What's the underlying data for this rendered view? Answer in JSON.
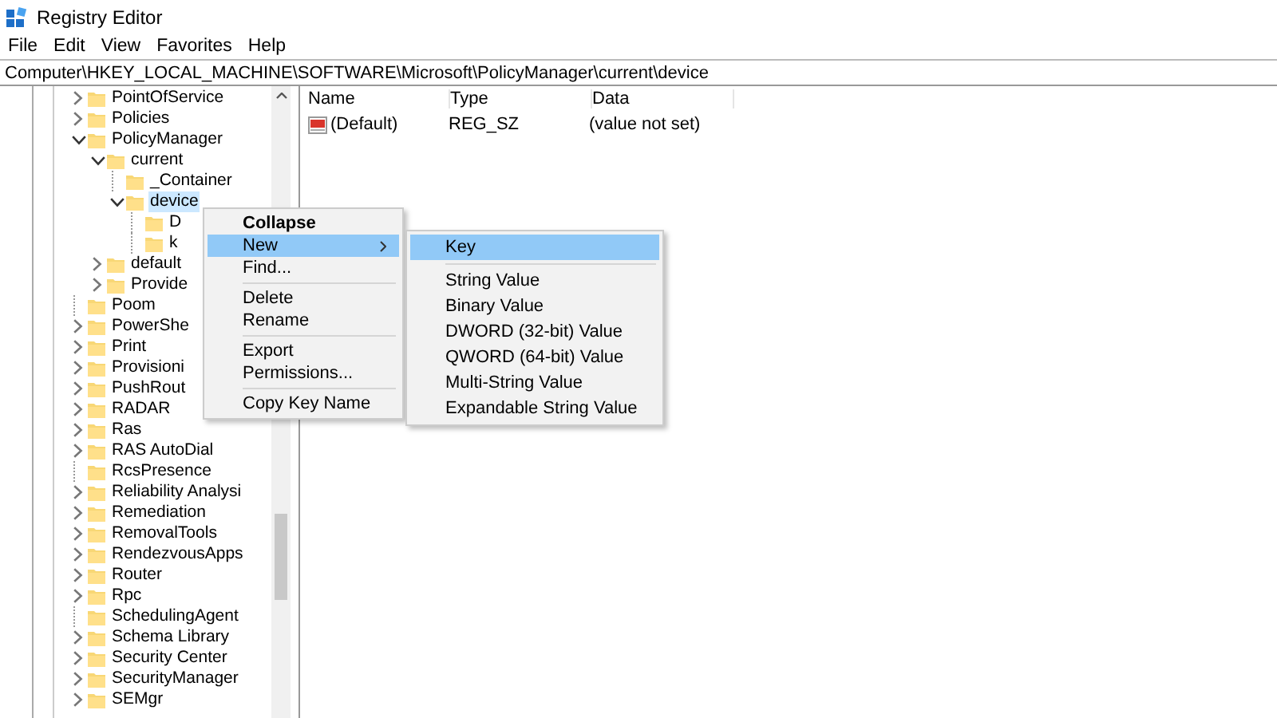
{
  "window": {
    "title": "Registry Editor"
  },
  "menu_bar": [
    "File",
    "Edit",
    "View",
    "Favorites",
    "Help"
  ],
  "address_bar": {
    "value": "Computer\\HKEY_LOCAL_MACHINE\\SOFTWARE\\Microsoft\\PolicyManager\\current\\device"
  },
  "tree": [
    {
      "label": "PointOfService",
      "kind": "branch",
      "expanded": false,
      "selected": false
    },
    {
      "label": "Policies",
      "kind": "branch",
      "expanded": false,
      "selected": false
    },
    {
      "label": "PolicyManager",
      "kind": "branch",
      "expanded": true,
      "selected": false,
      "children": [
        {
          "label": "current",
          "kind": "branch",
          "expanded": true,
          "selected": false,
          "children": [
            {
              "label": "_Container",
              "kind": "leaf",
              "selected": false
            },
            {
              "label": "device",
              "kind": "branch",
              "expanded": true,
              "selected": true,
              "children": [
                {
                  "label": "D",
                  "kind": "leaf",
                  "selected": false
                },
                {
                  "label": "k",
                  "kind": "leaf",
                  "selected": false
                }
              ]
            }
          ]
        },
        {
          "label": "default",
          "kind": "branch",
          "expanded": false,
          "selected": false
        },
        {
          "label": "Provide",
          "kind": "branch",
          "expanded": false,
          "selected": false
        }
      ]
    },
    {
      "label": "Poom",
      "kind": "leaf",
      "selected": false
    },
    {
      "label": "PowerShe",
      "kind": "branch",
      "expanded": false,
      "selected": false
    },
    {
      "label": "Print",
      "kind": "branch",
      "expanded": false,
      "selected": false
    },
    {
      "label": "Provisioni",
      "kind": "branch",
      "expanded": false,
      "selected": false
    },
    {
      "label": "PushRout",
      "kind": "branch",
      "expanded": false,
      "selected": false
    },
    {
      "label": "RADAR",
      "kind": "branch",
      "expanded": false,
      "selected": false
    },
    {
      "label": "Ras",
      "kind": "branch",
      "expanded": false,
      "selected": false
    },
    {
      "label": "RAS AutoDial",
      "kind": "branch",
      "expanded": false,
      "selected": false
    },
    {
      "label": "RcsPresence",
      "kind": "leaf",
      "selected": false
    },
    {
      "label": "Reliability Analysi",
      "kind": "branch",
      "expanded": false,
      "selected": false
    },
    {
      "label": "Remediation",
      "kind": "branch",
      "expanded": false,
      "selected": false
    },
    {
      "label": "RemovalTools",
      "kind": "branch",
      "expanded": false,
      "selected": false
    },
    {
      "label": "RendezvousApps",
      "kind": "branch",
      "expanded": false,
      "selected": false
    },
    {
      "label": "Router",
      "kind": "branch",
      "expanded": false,
      "selected": false
    },
    {
      "label": "Rpc",
      "kind": "branch",
      "expanded": false,
      "selected": false
    },
    {
      "label": "SchedulingAgent",
      "kind": "leaf",
      "selected": false
    },
    {
      "label": "Schema Library",
      "kind": "branch",
      "expanded": false,
      "selected": false
    },
    {
      "label": "Security Center",
      "kind": "branch",
      "expanded": false,
      "selected": false
    },
    {
      "label": "SecurityManager",
      "kind": "branch",
      "expanded": false,
      "selected": false
    },
    {
      "label": "SEMgr",
      "kind": "branch",
      "expanded": false,
      "selected": false
    }
  ],
  "values_table": {
    "columns": [
      "Name",
      "Type",
      "Data"
    ],
    "rows": [
      {
        "name": "(Default)",
        "type": "REG_SZ",
        "data": "(value not set)"
      }
    ]
  },
  "context_menu": {
    "sections": [
      [
        {
          "label": "Collapse",
          "kind": "default",
          "selected": false
        },
        {
          "label": "New",
          "kind": "submenu",
          "selected": true
        },
        {
          "label": "Find...",
          "kind": "item",
          "selected": false
        }
      ],
      [
        {
          "label": "Delete",
          "kind": "item",
          "selected": false
        },
        {
          "label": "Rename",
          "kind": "item",
          "selected": false
        }
      ],
      [
        {
          "label": "Export",
          "kind": "item",
          "selected": false
        },
        {
          "label": "Permissions...",
          "kind": "item",
          "selected": false
        }
      ],
      [
        {
          "label": "Copy Key Name",
          "kind": "item",
          "selected": false
        }
      ]
    ]
  },
  "submenu": {
    "sections": [
      [
        {
          "label": "Key",
          "kind": "item",
          "selected": true
        }
      ],
      [
        {
          "label": "String Value",
          "kind": "item",
          "selected": false
        },
        {
          "label": "Binary Value",
          "kind": "item",
          "selected": false
        },
        {
          "label": "DWORD (32-bit) Value",
          "kind": "item",
          "selected": false
        },
        {
          "label": "QWORD (64-bit) Value",
          "kind": "item",
          "selected": false
        },
        {
          "label": "Multi-String Value",
          "kind": "item",
          "selected": false
        },
        {
          "label": "Expandable String Value",
          "kind": "item",
          "selected": false
        }
      ]
    ]
  }
}
